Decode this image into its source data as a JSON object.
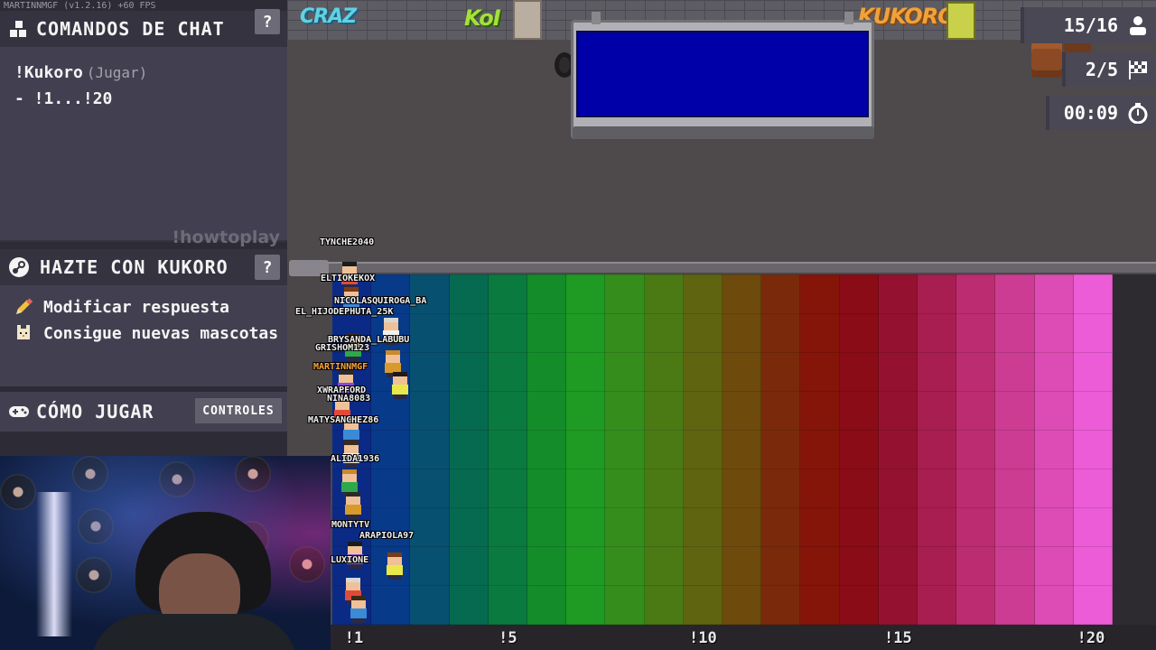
{
  "app": {
    "version_text": "MARTINNMGF (v1.2.16) +60 FPS"
  },
  "panel": {
    "chat_commands": {
      "title": "COMANDOS DE CHAT",
      "help_label": "?",
      "command": "!Kukoro",
      "command_note": "(Jugar)",
      "range": "- !1...!20",
      "hint": "!howtoplay"
    },
    "kukoro": {
      "title": "HAZTE CON KUKORO",
      "help_label": "?",
      "features": [
        {
          "icon": "pencil-icon",
          "label": "Modificar respuesta"
        },
        {
          "icon": "pet-icon",
          "label": "Consigue nuevas mascotas"
        }
      ]
    },
    "how_to": {
      "title": "CÓMO JUGAR",
      "controls_label": "CONTROLES"
    }
  },
  "hud": {
    "players": {
      "value": "15/16",
      "icon": "person-icon"
    },
    "round": {
      "value": "2/5",
      "icon": "checkered-flag-icon"
    },
    "timer": {
      "value": "00:09",
      "icon": "stopwatch-icon"
    }
  },
  "grid": {
    "answers": 20,
    "column_colors": [
      "#0b2a86",
      "#083a8a",
      "#075070",
      "#066a50",
      "#0a7a3e",
      "#148c2a",
      "#1f9a22",
      "#358e1c",
      "#4b7a14",
      "#5f6410",
      "#6e4a0c",
      "#7a2a0a",
      "#841508",
      "#8a0c16",
      "#941230",
      "#a81e50",
      "#bc2c70",
      "#cc3c92",
      "#dc4cb4",
      "#ec5cd6"
    ],
    "axis_labels": [
      "!1",
      "!5",
      "!10",
      "!15",
      "!20"
    ]
  },
  "players": [
    {
      "name": "TYNCHE2040",
      "highlight": false
    },
    {
      "name": "ELTIOKEKOX",
      "highlight": false
    },
    {
      "name": "NICOLASQUIROGA_BA",
      "highlight": false
    },
    {
      "name": "EL_HIJODEPHUTA_25K",
      "highlight": false
    },
    {
      "name": "BRYSANDA_LABUBU",
      "highlight": false
    },
    {
      "name": "GRISHOM123",
      "highlight": false
    },
    {
      "name": "MARTINNMGF",
      "highlight": true
    },
    {
      "name": "XWRAPFORD",
      "highlight": false
    },
    {
      "name": "NINA8083",
      "highlight": false
    },
    {
      "name": "MATYSANCHEZ86",
      "highlight": false
    },
    {
      "name": "ALIDA1936",
      "highlight": false
    },
    {
      "name": "MONTYTV",
      "highlight": false
    },
    {
      "name": "ARAPIOLA97",
      "highlight": false
    },
    {
      "name": "LUXIONE",
      "highlight": false
    }
  ]
}
